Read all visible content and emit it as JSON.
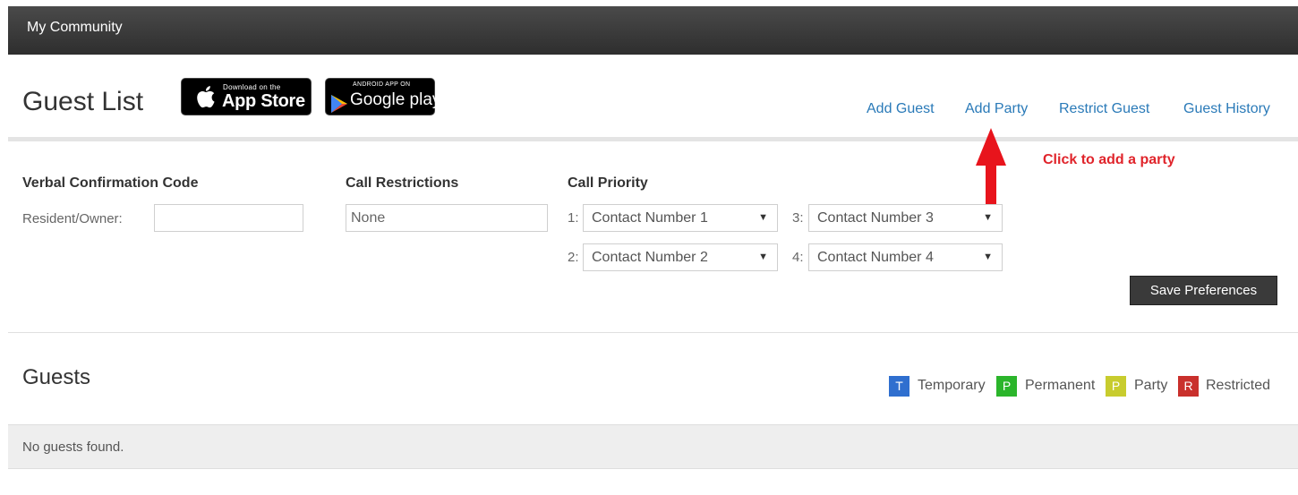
{
  "header": {
    "app_title": "My Community"
  },
  "page": {
    "title": "Guest List"
  },
  "badges": {
    "apple": {
      "small": "Download on the",
      "big": "App Store"
    },
    "google": {
      "small": "ANDROID APP ON",
      "big": "Google play"
    }
  },
  "nav": {
    "add_guest": "Add Guest",
    "add_party": "Add Party",
    "restrict_guest": "Restrict Guest",
    "guest_history": "Guest History"
  },
  "annotation": {
    "text": "Click to add a party",
    "color": "#e0242b"
  },
  "verbal_confirmation": {
    "heading": "Verbal Confirmation Code",
    "resident_label": "Resident/Owner:",
    "resident_value": ""
  },
  "call_restrictions": {
    "heading": "Call Restrictions",
    "value": "None"
  },
  "call_priority": {
    "heading": "Call Priority",
    "slots": [
      {
        "num": "1:",
        "value": "Contact Number 1"
      },
      {
        "num": "2:",
        "value": "Contact Number 2"
      },
      {
        "num": "3:",
        "value": "Contact Number 3"
      },
      {
        "num": "4:",
        "value": "Contact Number 4"
      }
    ]
  },
  "save_button": "Save Preferences",
  "guests": {
    "title": "Guests",
    "empty_message": "No guests found.",
    "legend": [
      {
        "letter": "T",
        "label": "Temporary",
        "color": "#2f6fcf"
      },
      {
        "letter": "P",
        "label": "Permanent",
        "color": "#2bb52b"
      },
      {
        "letter": "P",
        "label": "Party",
        "color": "#c8cc2e"
      },
      {
        "letter": "R",
        "label": "Restricted",
        "color": "#c9302c"
      }
    ]
  }
}
